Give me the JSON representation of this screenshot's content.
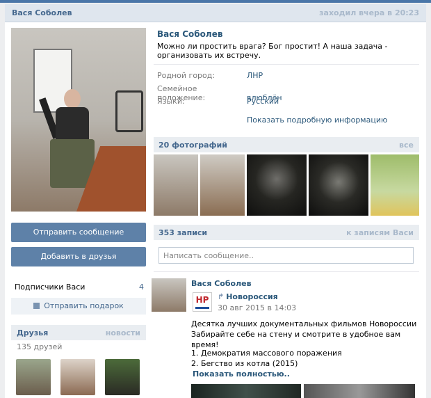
{
  "header": {
    "name": "Вася Соболев",
    "last_seen": "заходил вчера в 20:23"
  },
  "profile": {
    "name": "Вася Соболев",
    "status": "Можно ли простить врага? Бог простит! А наша задача - организовать их встречу.",
    "info": [
      {
        "label": "Родной город:",
        "value": "ЛНР"
      },
      {
        "label": "Семейное положение:",
        "value": "влюблён"
      },
      {
        "label": "Языки:",
        "value": "Русский"
      }
    ],
    "show_more": "Показать подробную информацию"
  },
  "actions": {
    "send_message": "Отправить сообщение",
    "add_friend": "Добавить в друзья",
    "send_gift": "Отправить подарок"
  },
  "followers": {
    "label": "Подписчики Васи",
    "count": "4"
  },
  "friends": {
    "title": "Друзья",
    "news_link": "новости",
    "count_text": "135 друзей"
  },
  "photos": {
    "title": "20 фотографий",
    "all_link": "все"
  },
  "wall": {
    "title": "353 записи",
    "to_link": "к записям Васи",
    "compose_placeholder": "Написать сообщение..",
    "post": {
      "author": "Вася Соболев",
      "repost_logo": "НР",
      "repost_source": "Новороссия",
      "repost_date": "30 авг 2015 в 14:03",
      "text_line1": "Десятка лучших документальных фильмов Новороссии",
      "text_line2": "Забирайте себе на стену и смотрите в удобное вам время!",
      "list_1": "1. Демократия массового поражения",
      "list_2": "2. Бегство из котла (2015)",
      "show_full": "Показать полностью.."
    }
  },
  "colors": {
    "accent": "#45688e",
    "button": "#5e81a8",
    "link": "#2b587a"
  }
}
